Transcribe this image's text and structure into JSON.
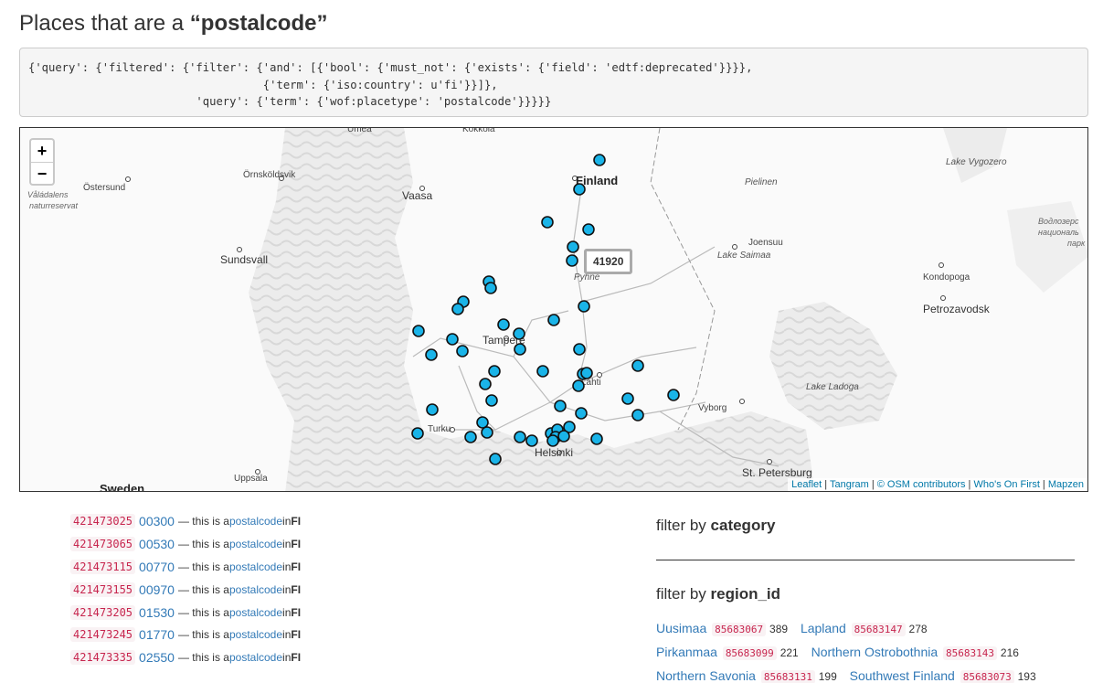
{
  "title": {
    "prefix": "Places that are a ",
    "term": "“postalcode”"
  },
  "query": "{'query': {'filtered': {'filter': {'and': [{'bool': {'must_not': {'exists': {'field': 'edtf:deprecated'}}}},\n                                   {'term': {'iso:country': u'fi'}}]},\n                         'query': {'term': {'wof:placetype': 'postalcode'}}}}}",
  "map": {
    "zoom_in": "+",
    "zoom_out": "−",
    "tooltip": "41920",
    "labels": [
      {
        "text": "Finland",
        "style": "country"
      },
      {
        "text": "Vaasa",
        "style": "city"
      },
      {
        "text": "Östersund",
        "style": "town"
      },
      {
        "text": "Örnsköldsvik",
        "style": "town"
      },
      {
        "text": "Våládalens",
        "style": "park"
      },
      {
        "text": "naturreservat",
        "style": "park"
      },
      {
        "text": "Sundsvall",
        "style": "city"
      },
      {
        "text": "Tampere",
        "style": "city"
      },
      {
        "text": "Helsinki",
        "style": "city"
      },
      {
        "text": "Turku",
        "style": "town"
      },
      {
        "text": "Uppsala",
        "style": "town"
      },
      {
        "text": "Sweden",
        "style": "country"
      },
      {
        "text": "Pielinen",
        "style": "lake"
      },
      {
        "text": "Joensuu",
        "style": "town"
      },
      {
        "text": "Lake Saimaa",
        "style": "lake"
      },
      {
        "text": "Pyhne",
        "style": "lake"
      },
      {
        "text": "Lake Vygozero",
        "style": "lake"
      },
      {
        "text": "Водлозерс",
        "style": "park"
      },
      {
        "text": "националь",
        "style": "park"
      },
      {
        "text": "парк",
        "style": "park"
      },
      {
        "text": "Kondopoga",
        "style": "town"
      },
      {
        "text": "Petrozavodsk",
        "style": "city"
      },
      {
        "text": "Lake Ladoga",
        "style": "lake"
      },
      {
        "text": "Vyborg",
        "style": "town"
      },
      {
        "text": "St. Petersburg",
        "style": "city"
      },
      {
        "text": "Lahti",
        "style": "town"
      },
      {
        "text": "Umea",
        "style": "town"
      },
      {
        "text": "Kokkola",
        "style": "town"
      }
    ],
    "attribution": [
      "Leaflet",
      "Tangram",
      "© OSM contributors",
      "Who's On First",
      "Mapzen"
    ],
    "marker_color": "#1ab4e8"
  },
  "results": [
    {
      "id": "421473025",
      "code": "00300",
      "mid": " — this is a ",
      "type": "postalcode",
      "in": " in ",
      "country": "FI"
    },
    {
      "id": "421473065",
      "code": "00530",
      "mid": " — this is a ",
      "type": "postalcode",
      "in": " in ",
      "country": "FI"
    },
    {
      "id": "421473115",
      "code": "00770",
      "mid": " — this is a ",
      "type": "postalcode",
      "in": " in ",
      "country": "FI"
    },
    {
      "id": "421473155",
      "code": "00970",
      "mid": " — this is a ",
      "type": "postalcode",
      "in": " in ",
      "country": "FI"
    },
    {
      "id": "421473205",
      "code": "01530",
      "mid": " — this is a ",
      "type": "postalcode",
      "in": " in ",
      "country": "FI"
    },
    {
      "id": "421473245",
      "code": "01770",
      "mid": " — this is a ",
      "type": "postalcode",
      "in": " in ",
      "country": "FI"
    },
    {
      "id": "421473335",
      "code": "02550",
      "mid": " — this is a ",
      "type": "postalcode",
      "in": " in ",
      "country": "FI"
    }
  ],
  "filters": {
    "category": {
      "prefix": "filter by ",
      "term": "category"
    },
    "region": {
      "prefix": "filter by ",
      "term": "region_id"
    },
    "regions": [
      {
        "name": "Uusimaa",
        "code": "85683067",
        "count": "389"
      },
      {
        "name": "Lapland",
        "code": "85683147",
        "count": "278"
      },
      {
        "name": "Pirkanmaa",
        "code": "85683099",
        "count": "221"
      },
      {
        "name": "Northern Ostrobothnia",
        "code": "85683143",
        "count": "216"
      },
      {
        "name": "Northern Savonia",
        "code": "85683131",
        "count": "199"
      },
      {
        "name": "Southwest Finland",
        "code": "85683073",
        "count": "193"
      }
    ]
  }
}
